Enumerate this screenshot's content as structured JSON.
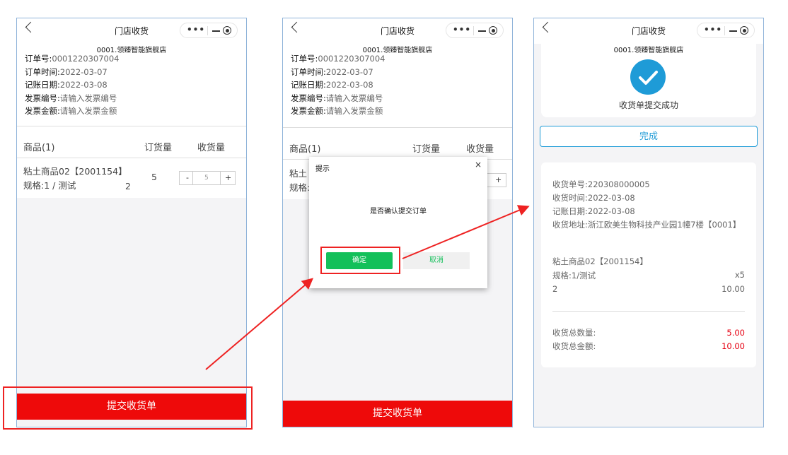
{
  "nav_title": "门店收货",
  "store": "0001.领臻智能旗舰店",
  "order": {
    "no_label": "订单号:",
    "no": "0001220307004",
    "time_label": "订单时间:",
    "time": "2022-03-07",
    "acct_label": "记账日期:",
    "acct": "2022-03-08",
    "inv_no_label": "发票编号:",
    "inv_no_ph": "请输入发票编号",
    "inv_amt_label": "发票金额:",
    "inv_amt_ph": "请输入发票金额"
  },
  "table": {
    "col_goods": "商品(1)",
    "col_order_qty": "订货量",
    "col_recv_qty": "收货量"
  },
  "product": {
    "name": "粘土商品02【2001154】",
    "spec": "规格:1 / 测试",
    "unit_qty": "2",
    "order_qty": "5",
    "stepper_value": "5",
    "minus": "-",
    "plus": "+"
  },
  "submit_label": "提交收货单",
  "dialog": {
    "title": "提示",
    "close": "×",
    "message": "是否确认提交订单",
    "ok": "确定",
    "cancel": "取消"
  },
  "success": {
    "message": "收货单提交成功",
    "done": "完成",
    "receipt_no": "收货单号:220308000005",
    "receipt_time": "收货时间:2022-03-08",
    "acct_date": "记账日期:2022-03-08",
    "address": "收货地址:浙江欧美生物科技产业园1幢7楼【0001】",
    "item_name": "粘土商品02【2001154】",
    "item_spec": "规格:1/测试",
    "item_qty": "x5",
    "item_unit": "2",
    "item_price": "10.00",
    "total_qty_label": "收货总数量:",
    "total_qty": "5.00",
    "total_amt_label": "收货总金额:",
    "total_amt": "10.00"
  },
  "colors": {
    "red": "#ee0a0a",
    "green": "#13c05a",
    "blue": "#1e9bd7",
    "highlight": "#ee2222"
  }
}
